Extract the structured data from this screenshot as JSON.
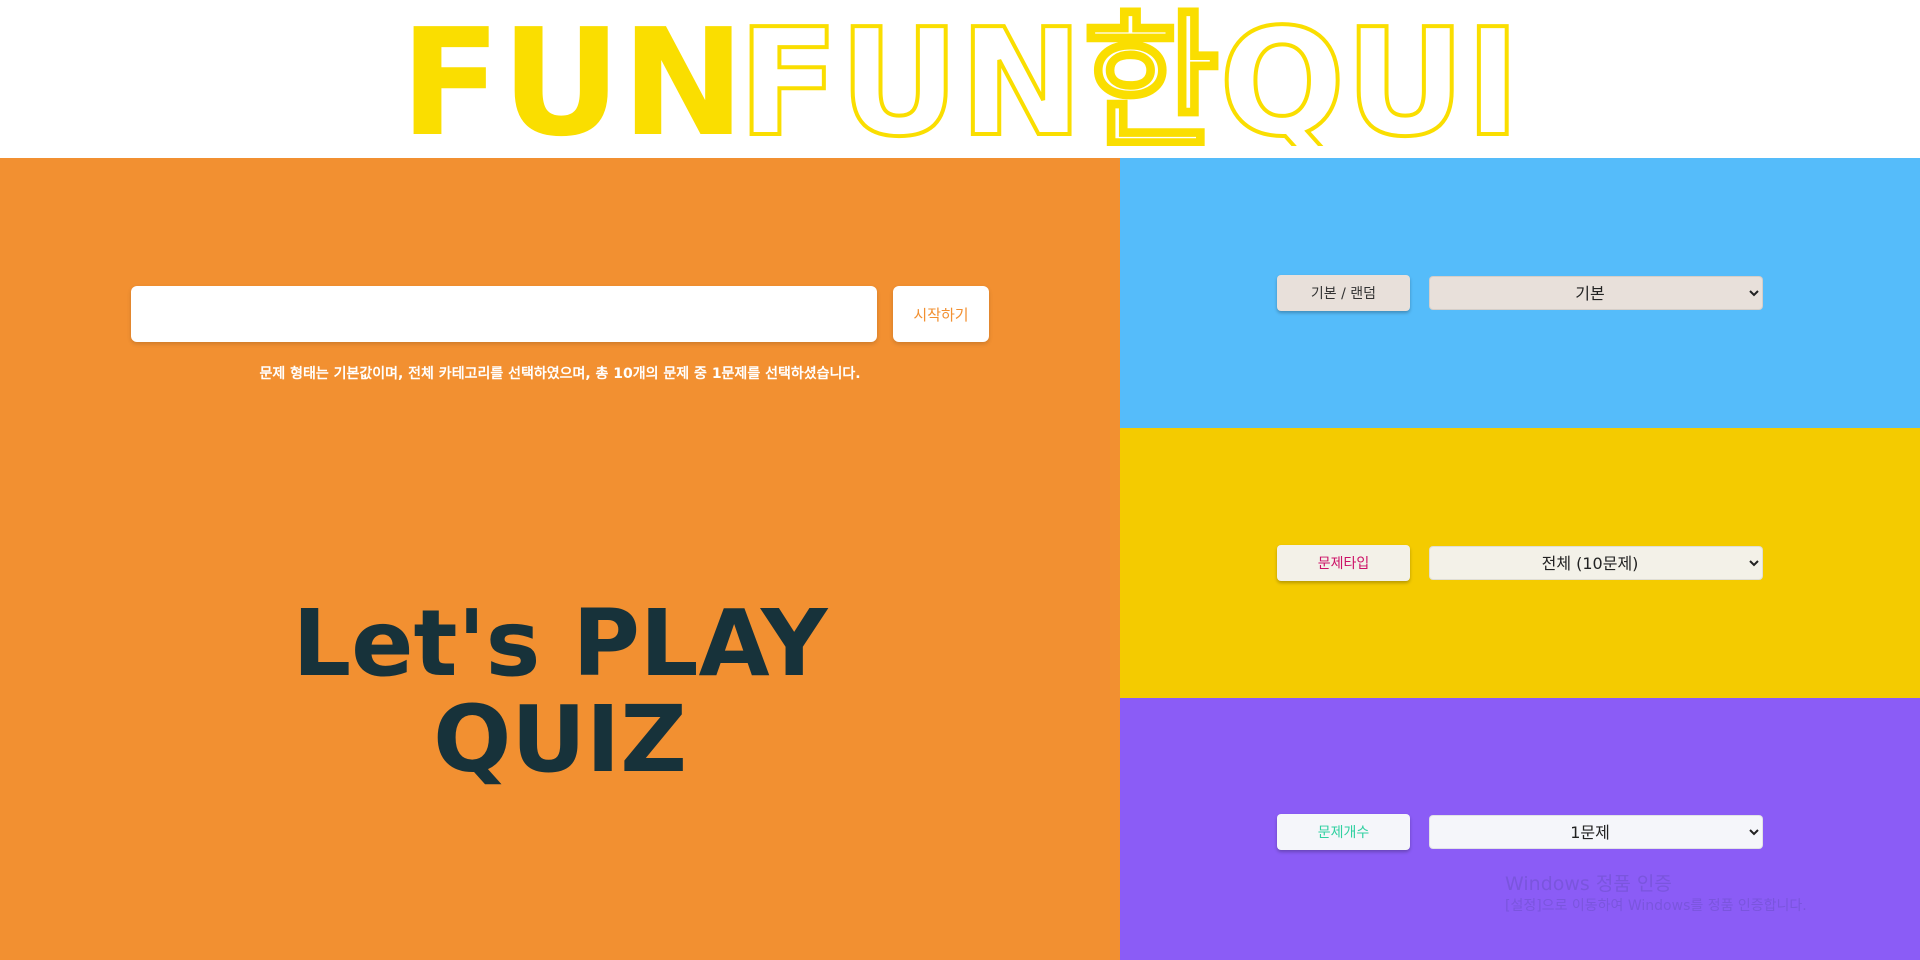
{
  "header": {
    "logo_fill_text": "FUN",
    "logo_outline_text": "FUN한QUIZ",
    "logo_color": "#fade00"
  },
  "left_panel": {
    "background": "#f29031",
    "search_value": "",
    "start_button_label": "시작하기",
    "start_button_color": "#f29031",
    "summary_text": "문제 형태는 기본값이며, 전체 카테고리를 선택하였으며, 총 10개의 문제 중 1문제를 선택하셨습니다.",
    "title_line1": "Let's PLAY",
    "title_line2": "QUIZ"
  },
  "right_panel": {
    "sections": [
      {
        "background": "#55bcfa",
        "label": "기본 / 랜덤",
        "label_bg": "#e8e0da",
        "label_color": "#333333",
        "select_value": "기본",
        "select_bg": "#e8e0da"
      },
      {
        "background": "#f4cb00",
        "label": "문제타입",
        "label_bg": "#f3f1e8",
        "label_color": "#cc1166",
        "select_value": "전체 (10문제)",
        "select_bg": "#f3f1e8"
      },
      {
        "background": "#8b5cf6",
        "label": "문제개수",
        "label_bg": "#f5f6fa",
        "label_color": "#2fd0a0",
        "select_value": "1문제",
        "select_bg": "#f5f6fa"
      }
    ]
  },
  "watermark": {
    "title": "Windows 정품 인증",
    "subtitle": "[설정]으로 이동하여 Windows를 정품 인증합니다."
  }
}
